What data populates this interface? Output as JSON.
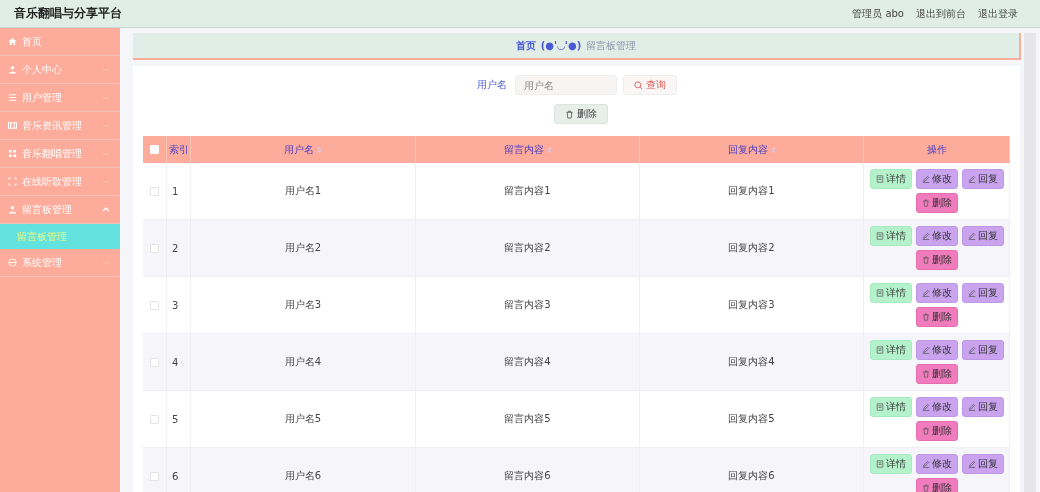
{
  "header": {
    "title": "音乐翻唱与分享平台",
    "links": [
      "管理员 abo",
      "退出到前台",
      "退出登录"
    ]
  },
  "sidebar": {
    "items": [
      {
        "label": "首页"
      },
      {
        "label": "个人中心",
        "expanded": false
      },
      {
        "label": "用户管理",
        "expanded": false
      },
      {
        "label": "音乐资讯管理",
        "expanded": false
      },
      {
        "label": "音乐翻唱管理",
        "expanded": false
      },
      {
        "label": "在线听歌管理",
        "expanded": false
      },
      {
        "label": "留言板管理",
        "expanded": true,
        "children": [
          {
            "label": "留言板管理",
            "selected": true
          }
        ]
      },
      {
        "label": "系统管理",
        "expanded": false
      }
    ]
  },
  "breadcrumb": {
    "home": "首页",
    "face": "(●'◡'●)",
    "current": "留言板管理"
  },
  "search": {
    "label": "用户名",
    "placeholder": "用户名",
    "button": "查询"
  },
  "delete_button": "删除",
  "table": {
    "select_all_checked": false,
    "columns": [
      {
        "label": "索引",
        "sortable": false
      },
      {
        "label": "用户名",
        "sortable": true
      },
      {
        "label": "留言内容",
        "sortable": true
      },
      {
        "label": "回复内容",
        "sortable": true
      },
      {
        "label": "操作",
        "sortable": false
      }
    ],
    "rows": [
      {
        "checked": false,
        "index": "1",
        "username": "用户名1",
        "message": "留言内容1",
        "reply": "回复内容1",
        "actions": [
          {
            "kind": "detail",
            "label": "详情"
          },
          {
            "kind": "edit",
            "label": "修改"
          },
          {
            "kind": "reply",
            "label": "回复"
          },
          {
            "kind": "delete",
            "label": "删除"
          }
        ]
      },
      {
        "checked": false,
        "index": "2",
        "username": "用户名2",
        "message": "留言内容2",
        "reply": "回复内容2",
        "actions": [
          {
            "kind": "detail",
            "label": "详情"
          },
          {
            "kind": "edit",
            "label": "修改"
          },
          {
            "kind": "reply",
            "label": "回复"
          },
          {
            "kind": "delete",
            "label": "删除"
          }
        ]
      },
      {
        "checked": false,
        "index": "3",
        "username": "用户名3",
        "message": "留言内容3",
        "reply": "回复内容3",
        "actions": [
          {
            "kind": "detail",
            "label": "详情"
          },
          {
            "kind": "edit",
            "label": "修改"
          },
          {
            "kind": "reply",
            "label": "回复"
          },
          {
            "kind": "delete",
            "label": "删除"
          }
        ]
      },
      {
        "checked": false,
        "index": "4",
        "username": "用户名4",
        "message": "留言内容4",
        "reply": "回复内容4",
        "actions": [
          {
            "kind": "detail",
            "label": "详情"
          },
          {
            "kind": "edit",
            "label": "修改"
          },
          {
            "kind": "reply",
            "label": "回复"
          },
          {
            "kind": "delete",
            "label": "删除"
          }
        ]
      },
      {
        "checked": false,
        "index": "5",
        "username": "用户名5",
        "message": "留言内容5",
        "reply": "回复内容5",
        "actions": [
          {
            "kind": "detail",
            "label": "详情"
          },
          {
            "kind": "edit",
            "label": "修改"
          },
          {
            "kind": "reply",
            "label": "回复"
          },
          {
            "kind": "delete",
            "label": "删除"
          }
        ]
      },
      {
        "checked": false,
        "index": "6",
        "username": "用户名6",
        "message": "留言内容6",
        "reply": "回复内容6",
        "actions": [
          {
            "kind": "detail",
            "label": "详情"
          },
          {
            "kind": "edit",
            "label": "修改"
          },
          {
            "kind": "reply",
            "label": "回复"
          },
          {
            "kind": "delete",
            "label": "删除"
          }
        ]
      }
    ]
  }
}
